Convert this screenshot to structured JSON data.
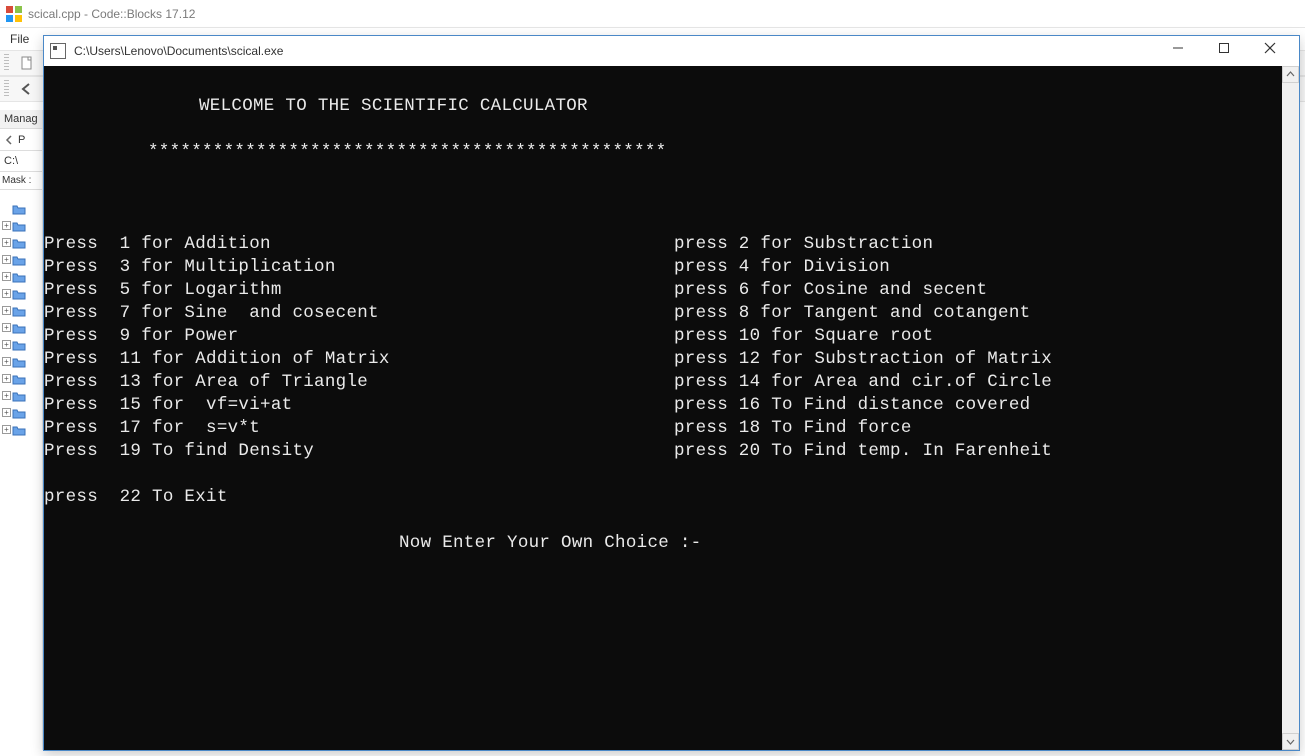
{
  "cb_title": "scical.cpp - Code::Blocks 17.12",
  "menubar": {
    "file": "File"
  },
  "left_panel": {
    "management": "Manag",
    "tab_p": "P",
    "drive": "C:\\",
    "mask": "Mask :"
  },
  "console": {
    "title": "C:\\Users\\Lenovo\\Documents\\scical.exe",
    "welcome": "WELCOME TO THE SCIENTIFIC CALCULATOR",
    "stars": "************************************************",
    "rows": [
      {
        "left": "Press  1 for Addition",
        "right": "press 2 for Substraction"
      },
      {
        "left": "Press  3 for Multiplication",
        "right": "press 4 for Division"
      },
      {
        "left": "Press  5 for Logarithm",
        "right": "press 6 for Cosine and secent"
      },
      {
        "left": "Press  7 for Sine  and cosecent",
        "right": "press 8 for Tangent and cotangent"
      },
      {
        "left": "Press  9 for Power",
        "right": "press 10 for Square root"
      },
      {
        "left": "Press  11 for Addition of Matrix",
        "right": "press 12 for Substraction of Matrix"
      },
      {
        "left": "Press  13 for Area of Triangle",
        "right": "press 14 for Area and cir.of Circle"
      },
      {
        "left": "Press  15 for  vf=vi+at",
        "right": "press 16 To Find distance covered"
      },
      {
        "left": "Press  17 for  s=v*t",
        "right": "press 18 To Find force"
      },
      {
        "left": "Press  19 To find Density",
        "right": "press 20 To Find temp. In Farenheit"
      }
    ],
    "exit_row": "press  22 To Exit",
    "prompt": "Now Enter Your Own Choice :-"
  }
}
